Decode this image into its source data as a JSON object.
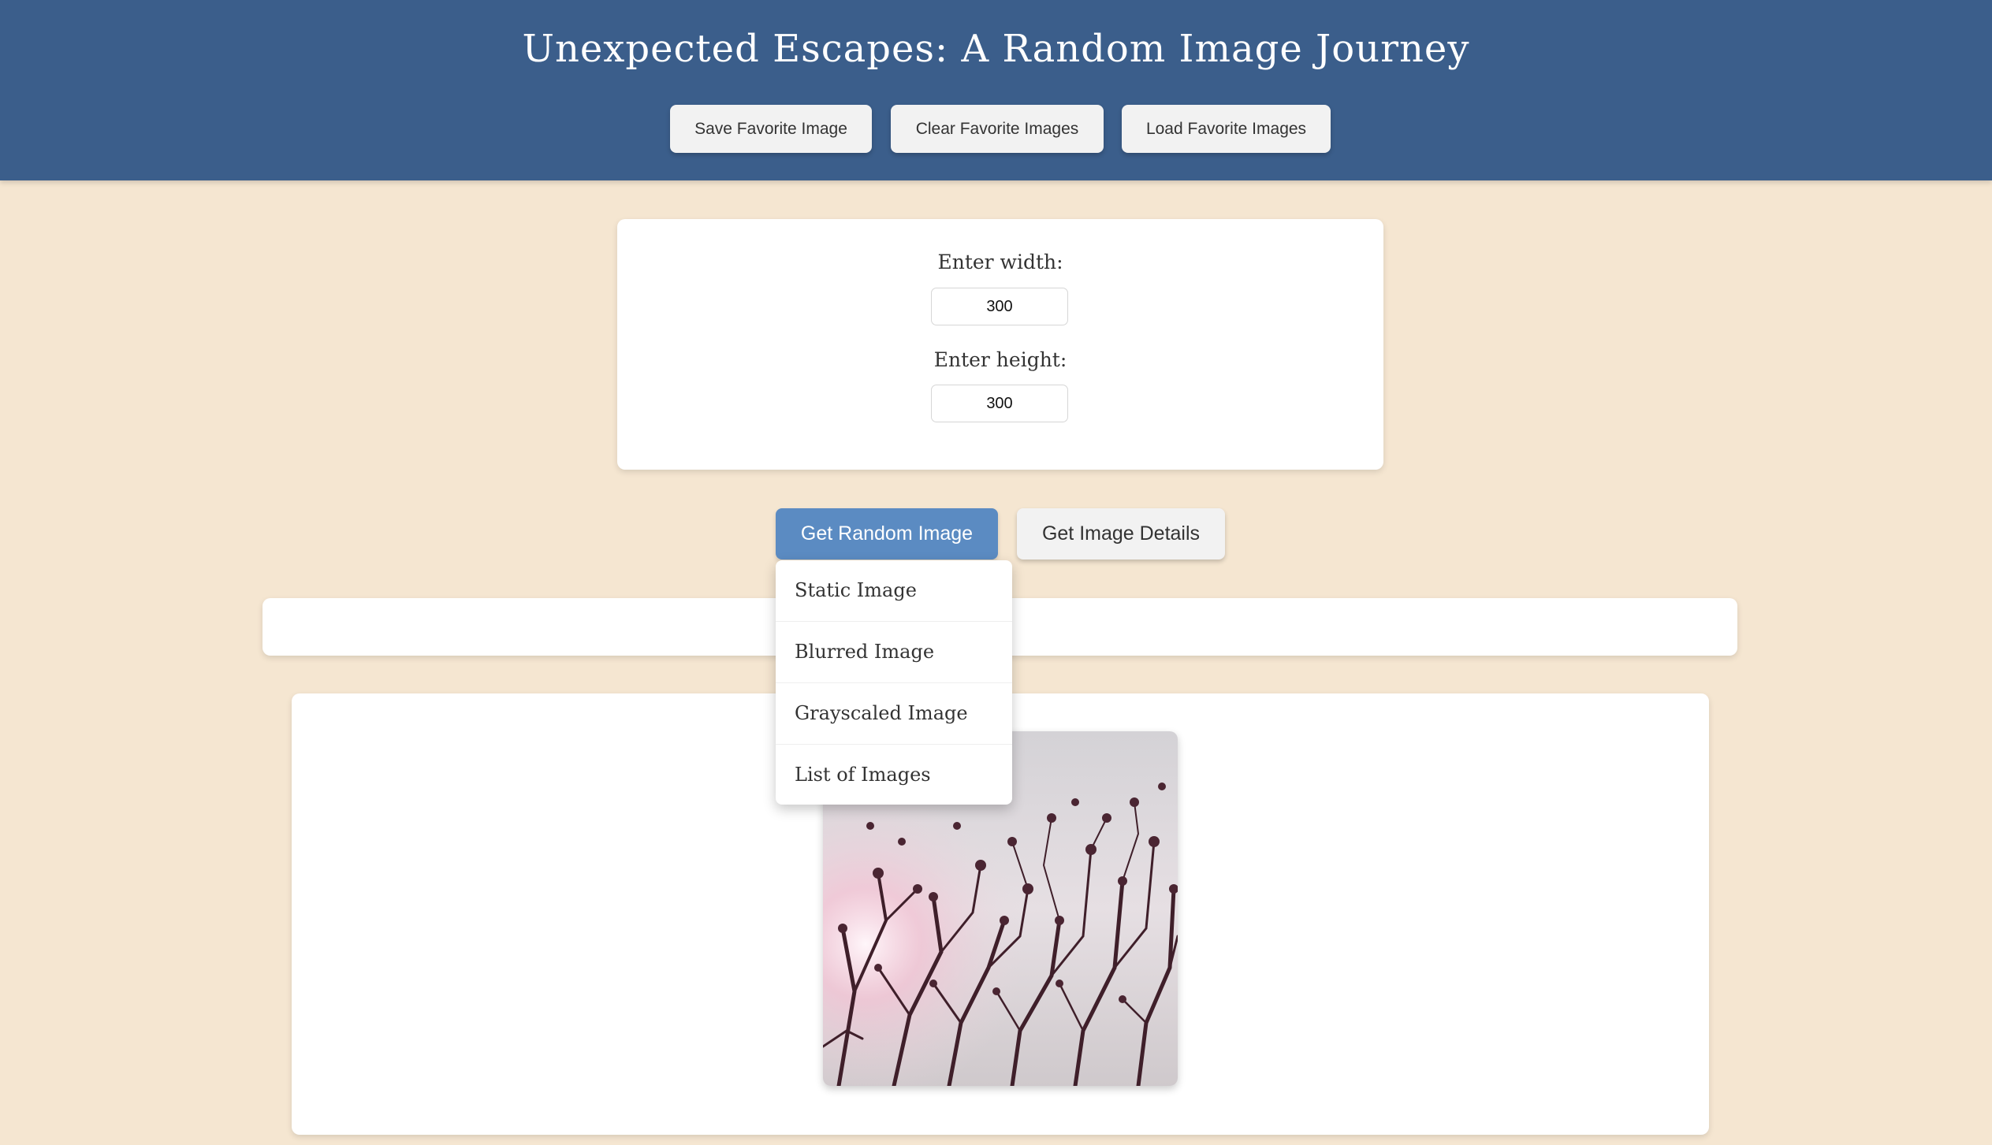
{
  "header": {
    "title": "Unexpected Escapes: A Random Image Journey",
    "buttons": {
      "save": "Save Favorite Image",
      "clear": "Clear Favorite Images",
      "load": "Load Favorite Images"
    }
  },
  "dimensions": {
    "width_label": "Enter width:",
    "width_value": "300",
    "height_label": "Enter height:",
    "height_value": "300"
  },
  "actions": {
    "random_label": "Get Random Image",
    "details_label": "Get Image Details"
  },
  "dropdown": {
    "items": [
      "Static Image",
      "Blurred Image",
      "Grayscaled Image",
      "List of Images"
    ]
  },
  "image": {
    "alt": "random-photo"
  },
  "colors": {
    "header_bg": "#3b5e8b",
    "page_bg": "#f5e6d1",
    "primary_button": "#5b8bc2"
  }
}
